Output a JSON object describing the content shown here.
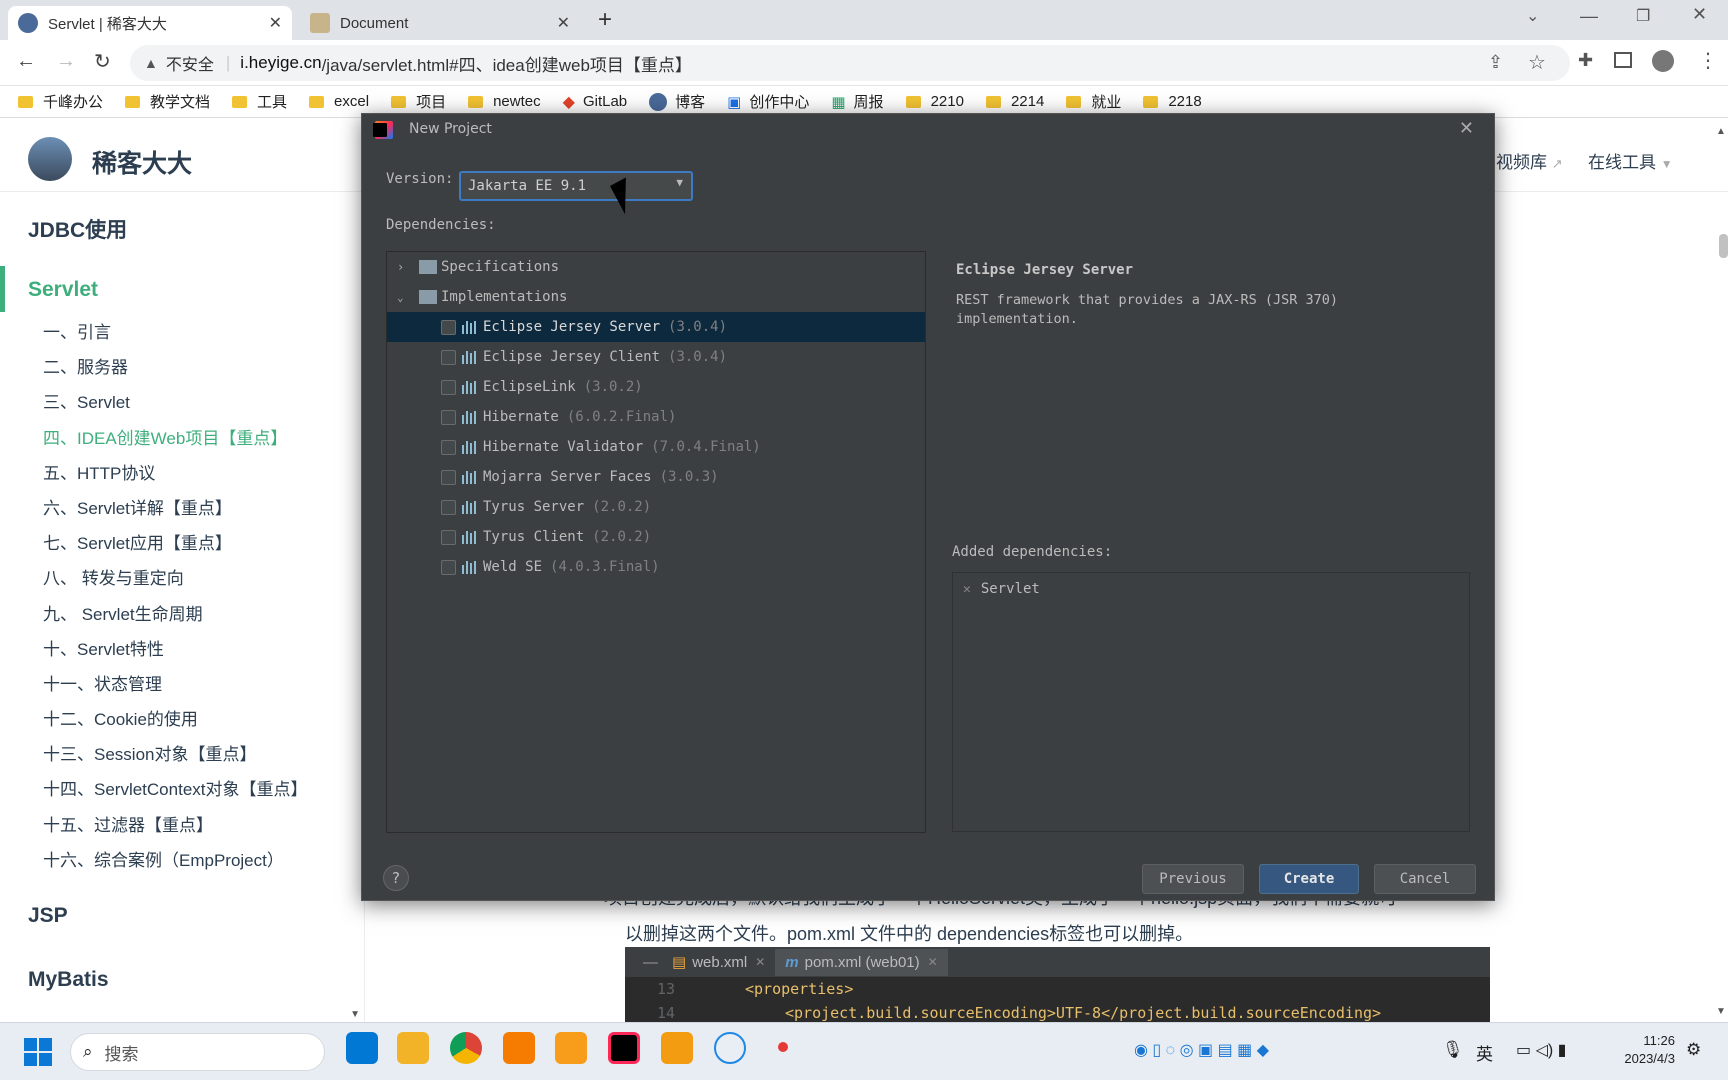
{
  "browser": {
    "tabs": [
      {
        "title": "Servlet | 稀客大大",
        "active": true
      },
      {
        "title": "Document",
        "active": false
      }
    ],
    "new_tab": "+",
    "security_label": "不安全",
    "url_host": "i.heyige.cn",
    "url_path": "/java/servlet.html#四、idea创建web项目【重点】",
    "bookmarks": [
      "千峰办公",
      "教学文档",
      "工具",
      "excel",
      "项目",
      "newtec",
      "GitLab",
      "博客",
      "创作中心",
      "周报",
      "2210",
      "2214",
      "就业",
      "2218"
    ]
  },
  "site": {
    "name": "稀客大大",
    "nav": [
      "视频库",
      "在线工具"
    ],
    "sidebar": {
      "sections": [
        "JDBC使用",
        "Servlet",
        "JSP",
        "MyBatis"
      ],
      "servlet_items": [
        "一、引言",
        "二、服务器",
        "三、Servlet",
        "四、IDEA创建Web项目【重点】",
        "五、HTTP协议",
        "六、Servlet详解【重点】",
        "七、Servlet应用【重点】",
        "八、 转发与重定向",
        "九、 Servlet生命周期",
        "十、Servlet特性",
        "十一、状态管理",
        "十二、Cookie的使用",
        "十三、Session对象【重点】",
        "十四、ServletContext对象【重点】",
        "十五、过滤器【重点】",
        "十六、综合案例（EmpProject）"
      ],
      "active_index": 3
    },
    "content": {
      "text_line1": "项目创建完成后，默认给我们生成了一个HelloServlet类，生成了一个hello.jsp页面，我们不需要就可",
      "text_line2": "以删掉这两个文件。pom.xml 文件中的 dependencies标签也可以删掉。",
      "editor_tabs": [
        "web.xml",
        "pom.xml (web01)"
      ],
      "code": [
        {
          "line": "13",
          "text": "<properties>"
        },
        {
          "line": "14",
          "text": "<project.build.sourceEncoding>UTF-8</project.build.sourceEncoding>"
        }
      ]
    }
  },
  "dialog": {
    "title": "New Project",
    "version_label": "Version:",
    "version_value": "Jakarta EE 9.1",
    "dependencies_label": "Dependencies:",
    "groups": [
      {
        "name": "Specifications",
        "expanded": false
      },
      {
        "name": "Implementations",
        "expanded": true
      }
    ],
    "items": [
      {
        "name": "Eclipse Jersey Server",
        "version": "(3.0.4)",
        "selected": true
      },
      {
        "name": "Eclipse Jersey Client",
        "version": "(3.0.4)"
      },
      {
        "name": "EclipseLink",
        "version": "(3.0.2)"
      },
      {
        "name": "Hibernate",
        "version": "(6.0.2.Final)"
      },
      {
        "name": "Hibernate Validator",
        "version": "(7.0.4.Final)"
      },
      {
        "name": "Mojarra Server Faces",
        "version": "(3.0.3)"
      },
      {
        "name": "Tyrus Server",
        "version": "(2.0.2)"
      },
      {
        "name": "Tyrus Client",
        "version": "(2.0.2)"
      },
      {
        "name": "Weld SE",
        "version": "(4.0.3.Final)"
      }
    ],
    "detail_title": "Eclipse Jersey Server",
    "detail_desc_1": "REST framework that provides a JAX-RS (JSR 370)",
    "detail_desc_2": "implementation.",
    "added_label": "Added dependencies:",
    "added": [
      "Servlet"
    ],
    "help": "?",
    "buttons": {
      "previous": "Previous",
      "create": "Create",
      "cancel": "Cancel"
    }
  },
  "taskbar": {
    "search_placeholder": "搜索",
    "ime": "英",
    "time": "11:26",
    "date": "2023/4/3"
  },
  "colors": {
    "accent_green": "#3eaf7c",
    "dialog_bg": "#3c3f41",
    "selection": "#0d293e",
    "create_btn": "#365880"
  }
}
